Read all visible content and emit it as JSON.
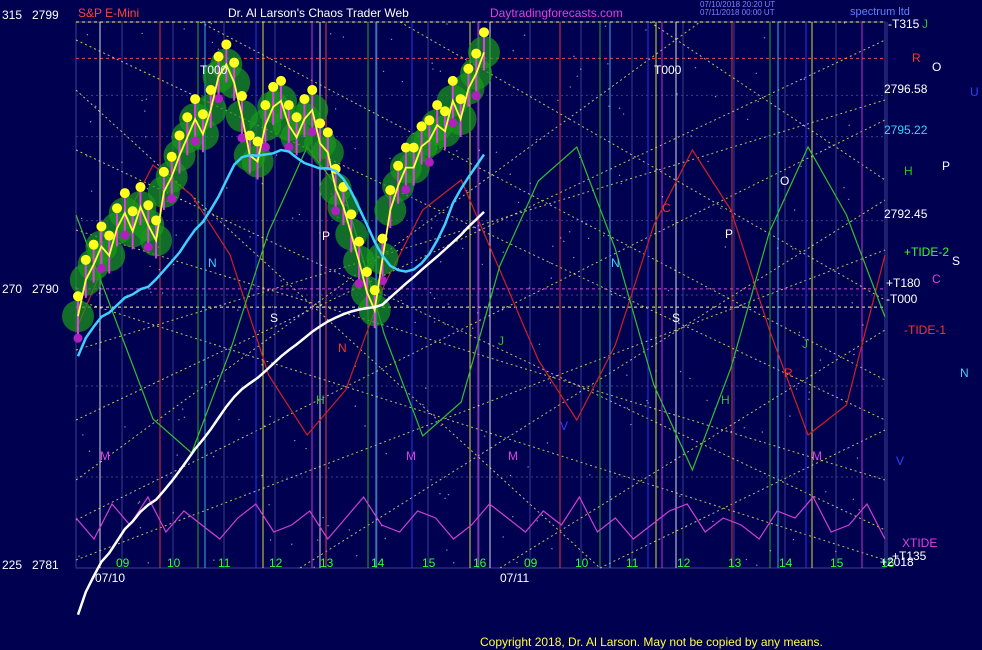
{
  "header": {
    "symbol": "S&P E-Mini",
    "site": "Dr. Al Larson's Chaos Trader Web",
    "url": "Daytradingforecasts.com",
    "stamp1": "07/10/2018 20:20 UT",
    "stamp2": "07/11/2018 00:00 UT",
    "brand": "spectrum ltd"
  },
  "copyright": "Copyright 2018, Dr. Al Larson. May not be copied by any means.",
  "colors": {
    "background": "#000050",
    "grid": "#3c3c8c",
    "price_bars": "#e040e0",
    "glow": "#1a9a1a",
    "fast_ma": "#ffff40",
    "mid_ma": "#40d0ff",
    "slow_ma": "#ffffff",
    "tide_red": "#d02020",
    "tide_green": "#30c030",
    "xtide": "#d040d0",
    "flux": "#ffff60"
  },
  "left_axis": [
    {
      "a": "315",
      "b": "2799"
    },
    {
      "a": "270",
      "b": "2790"
    },
    {
      "a": "225",
      "b": "2781"
    }
  ],
  "right_labels": {
    "t315": "-T315",
    "j": "J",
    "r": "R",
    "o": "O",
    "t000a": "T000",
    "t000b": "T000",
    "p2796": "2796.58",
    "u": "U",
    "p2795": "2795.22",
    "h": "H",
    "p": "P",
    "p2792": "2792.45",
    "tide2": "+TIDE-2",
    "s": "S",
    "c": "C",
    "t180": "+T180",
    "t000c": "-T000",
    "tide1": "-TIDE-1",
    "n": "N",
    "v": "V",
    "xtide": "XTIDE",
    "t135": "+T135",
    "t2018": "+2018"
  },
  "chart_labels": {
    "n1": "N",
    "s1": "S",
    "p1": "P",
    "h1": "H",
    "m1": "M",
    "j1": "J",
    "n2": "N",
    "s2": "S",
    "h2": "H",
    "p2": "P",
    "o2": "O",
    "r2": "R",
    "j2": "J",
    "m2": "M",
    "m3": "M",
    "m4": "M",
    "v1": "V",
    "c1": "C",
    "n3": "N"
  },
  "chart_data": {
    "type": "line",
    "title": "S&P E-Mini",
    "x_tick_labels": [
      "09",
      "10",
      "11",
      "12",
      "13",
      "14",
      "15",
      "16",
      "09",
      "10",
      "11",
      "12",
      "13",
      "14",
      "15",
      "16"
    ],
    "date_labels": [
      "07/10",
      "07/11"
    ],
    "y_tick_labels": [
      "2799",
      "2790",
      "2781"
    ],
    "ylim": [
      2781,
      2799
    ],
    "price_levels": [
      2796.58,
      2795.22,
      2792.45
    ],
    "price_series": [
      2789.3,
      2790.5,
      2791.0,
      2791.6,
      2791.3,
      2792.2,
      2792.7,
      2792.1,
      2792.9,
      2792.3,
      2791.8,
      2793.4,
      2793.9,
      2794.6,
      2795.2,
      2795.8,
      2795.3,
      2796.1,
      2797.2,
      2797.6,
      2797.0,
      2795.9,
      2794.6,
      2794.4,
      2795.6,
      2796.2,
      2796.4,
      2795.6,
      2795.2,
      2795.8,
      2796.1,
      2795.0,
      2794.7,
      2793.5,
      2792.9,
      2792.0,
      2791.1,
      2790.1,
      2789.5,
      2791.2,
      2792.8,
      2793.6,
      2794.2,
      2794.2,
      2794.9,
      2795.1,
      2795.6,
      2795.4,
      2796.4,
      2795.8,
      2796.8,
      2797.3,
      2798.0
    ],
    "series": [
      {
        "name": "XTIDE",
        "values": [
          0.6,
          0.3,
          0.8,
          0.5,
          0.9,
          0.4,
          0.7,
          0.5,
          0.3,
          0.6,
          0.8,
          0.4,
          0.5,
          0.7,
          0.3,
          0.6,
          0.9,
          0.5,
          0.4,
          0.7,
          0.6,
          0.3,
          0.5,
          0.8,
          0.6,
          0.4,
          0.7,
          0.5,
          0.9,
          0.4,
          0.6,
          0.3,
          0.5,
          0.7,
          0.8,
          0.4,
          0.6,
          0.5,
          0.3,
          0.7,
          0.6,
          0.9,
          0.4,
          0.5,
          0.8,
          0.3
        ]
      },
      {
        "name": "-TIDE-1",
        "values": [
          -0.2,
          0.4,
          0.9,
          0.7,
          0.3,
          -0.5,
          -0.9,
          -0.6,
          0.1,
          0.6,
          0.8,
          0.2,
          -0.4,
          -0.8,
          -0.3,
          0.5,
          1.0,
          0.6,
          -0.2,
          -0.9,
          -0.7,
          0.3
        ]
      },
      {
        "name": "+TIDE-2",
        "values": [
          0.5,
          -0.1,
          -0.7,
          -0.9,
          -0.3,
          0.4,
          0.9,
          0.6,
          -0.2,
          -0.8,
          -0.6,
          0.2,
          0.7,
          0.9,
          0.3,
          -0.5,
          -1.0,
          -0.4,
          0.4,
          0.9,
          0.5,
          -0.1
        ]
      }
    ]
  }
}
